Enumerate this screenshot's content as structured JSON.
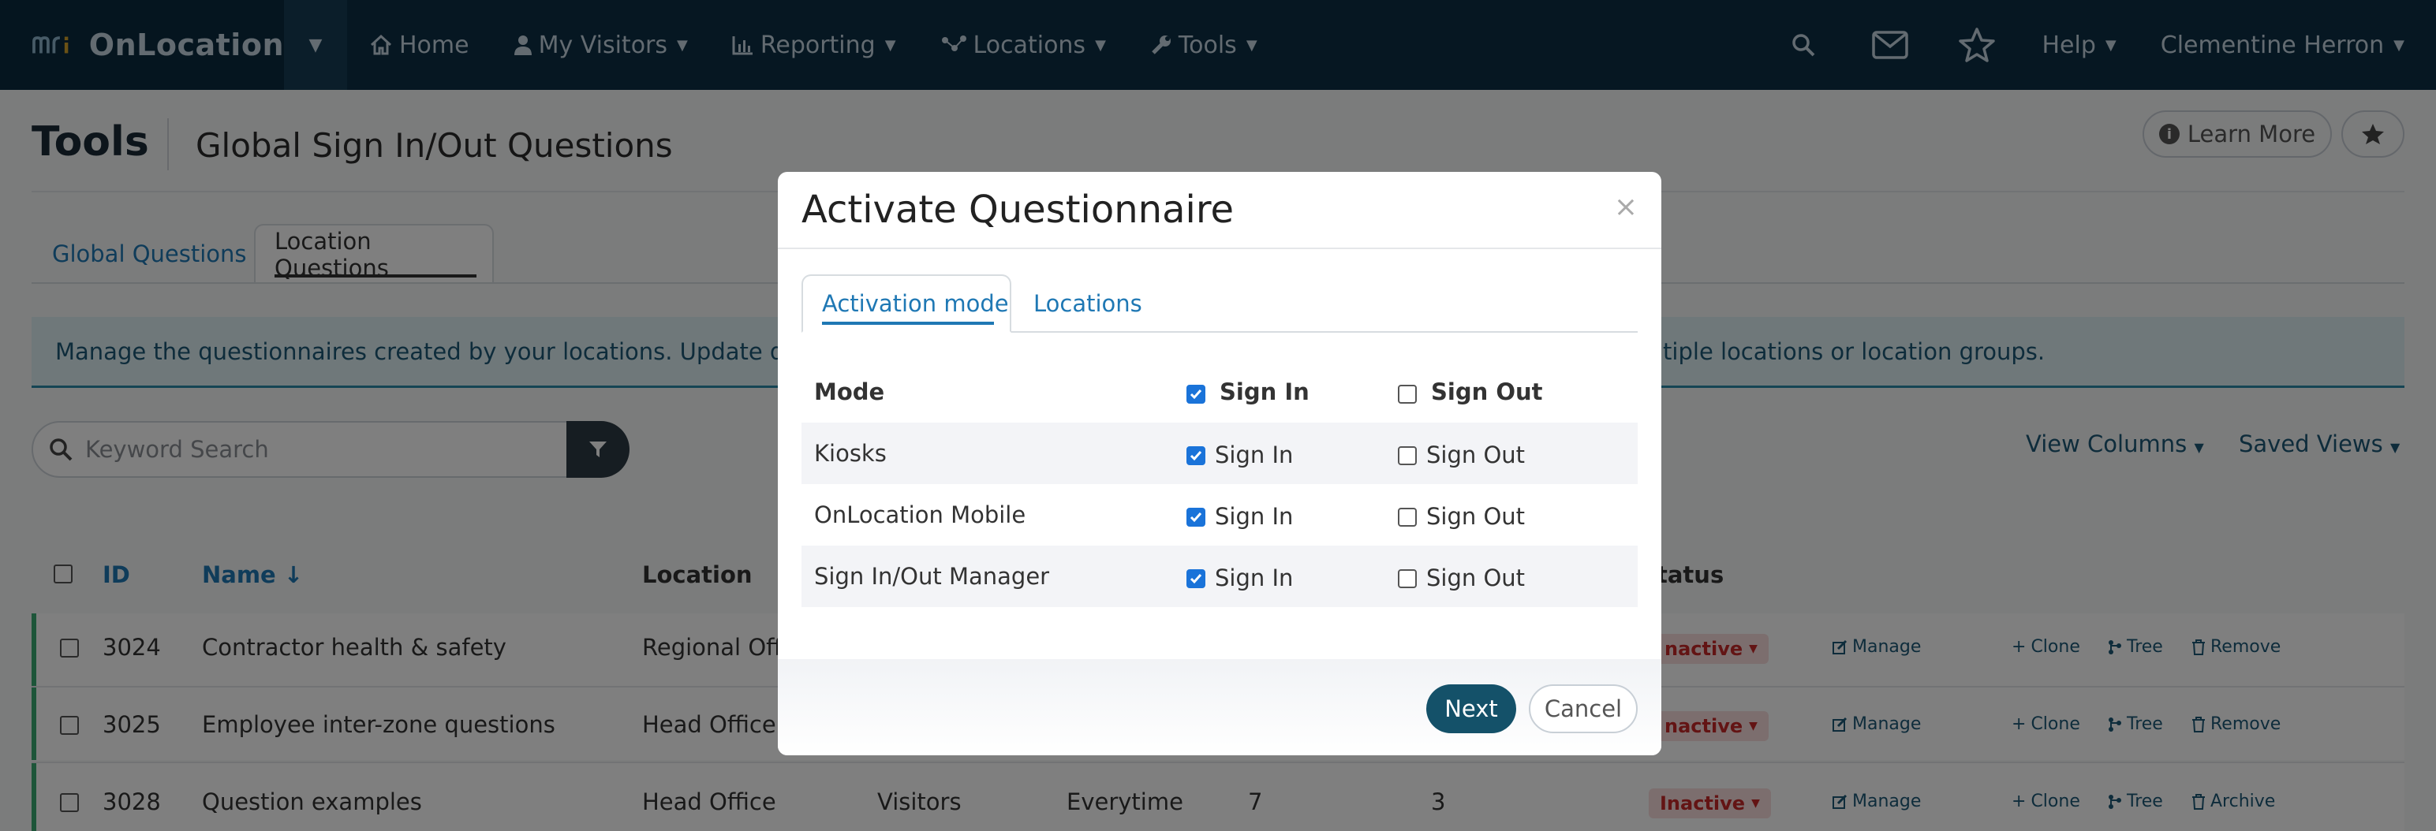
{
  "app": {
    "brand": "OnLocation"
  },
  "nav": {
    "items": [
      {
        "label": "Home"
      },
      {
        "label": "My Visitors"
      },
      {
        "label": "Reporting"
      },
      {
        "label": "Locations"
      },
      {
        "label": "Tools"
      }
    ],
    "help": "Help",
    "user": "Clementine Herron"
  },
  "page": {
    "title": "Tools",
    "subtitle": "Global Sign In/Out Questions",
    "learn_more": "Learn More"
  },
  "tabs": [
    {
      "label": "Global Questions",
      "active": false
    },
    {
      "label": "Location Questions",
      "active": true
    }
  ],
  "info": {
    "text_left": "Manage the questionnaires created by your locations. Update questio",
    "text_right": "ltiple locations or location groups."
  },
  "search": {
    "placeholder": "Keyword Search"
  },
  "toolbar": {
    "view_columns": "View Columns",
    "saved_views": "Saved Views"
  },
  "table": {
    "headers": {
      "id": "ID",
      "name": "Name ↓",
      "location": "Location",
      "status": "tatus"
    },
    "rows": [
      {
        "id": "3024",
        "name": "Contractor health & safety",
        "location": "Regional Offi",
        "extra": [],
        "status": "nactive",
        "actions": [
          "Manage",
          "Clone",
          "Tree",
          "Remove"
        ]
      },
      {
        "id": "3025",
        "name": "Employee inter-zone questions",
        "location": "Head Office",
        "extra": [],
        "status": "nactive",
        "actions": [
          "Manage",
          "Clone",
          "Tree",
          "Remove"
        ]
      },
      {
        "id": "3028",
        "name": "Question examples",
        "location": "Head Office",
        "extra": [
          "Visitors",
          "Everytime",
          "7",
          "3"
        ],
        "status": "Inactive",
        "actions": [
          "Manage",
          "Clone",
          "Tree",
          "Archive"
        ]
      }
    ]
  },
  "modal": {
    "title": "Activate Questionnaire",
    "close": "×",
    "tabs": [
      {
        "label": "Activation mode",
        "active": true
      },
      {
        "label": "Locations",
        "active": false
      }
    ],
    "header": {
      "mode": "Mode",
      "sign_in": "Sign In",
      "sign_out": "Sign Out",
      "sign_in_checked": true,
      "sign_out_checked": false
    },
    "rows": [
      {
        "mode": "Kiosks",
        "sign_in_label": "Sign In",
        "sign_out_label": "Sign Out",
        "sign_in": true,
        "sign_out": false
      },
      {
        "mode": "OnLocation Mobile",
        "sign_in_label": "Sign In",
        "sign_out_label": "Sign Out",
        "sign_in": true,
        "sign_out": false
      },
      {
        "mode": "Sign In/Out Manager",
        "sign_in_label": "Sign In",
        "sign_out_label": "Sign Out",
        "sign_in": true,
        "sign_out": false
      }
    ],
    "buttons": {
      "next": "Next",
      "cancel": "Cancel"
    }
  },
  "colors": {
    "nav_bg": "#0d2f45",
    "accent": "#1f78b4",
    "primary_button": "#145169",
    "inactive_badge": "#c62828",
    "checkbox_on": "#1a73d9"
  }
}
